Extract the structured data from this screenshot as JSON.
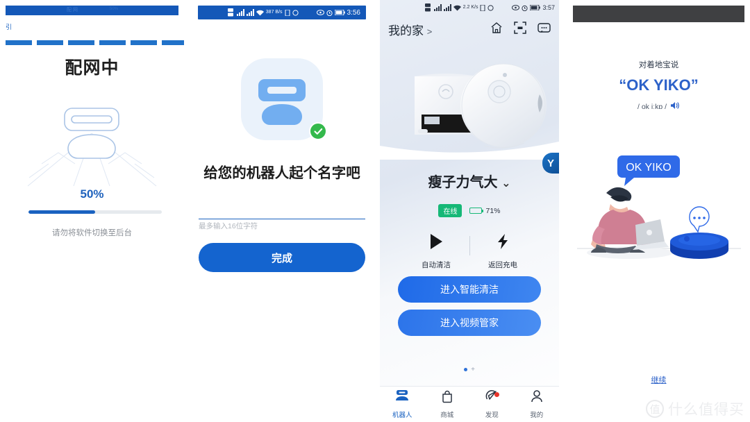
{
  "panel1": {
    "title": "配网中",
    "glitch_text": "配网",
    "glitch_text2": "50%",
    "stray": "引",
    "progress_label": "50%",
    "progress_value": 50,
    "hint": "请勿将软件切换至后台",
    "icons": {
      "illustration": "robot-dock-illustration"
    },
    "colors": {
      "accent": "#1a62c0",
      "track": "#e6eaee"
    }
  },
  "panel2": {
    "statusbar": {
      "network_speed": "387 B/s",
      "time": "3:56",
      "icons": [
        "dual-sim-icon",
        "signal-icon",
        "signal-icon",
        "wifi-icon",
        "speed-icon",
        "vibrate-icon",
        "sync-icon",
        "eye-icon",
        "alarm-icon",
        "battery-icon"
      ]
    },
    "title": "给您的机器人起个名字吧",
    "input_value": "",
    "input_placeholder": "",
    "input_hint": "最多输入16位字符",
    "submit_label": "完成",
    "icons": {
      "avatar": "robot-avatar-icon",
      "status": "success-check-icon"
    },
    "colors": {
      "accent": "#1464cf",
      "success": "#34b94c",
      "avatar_bg": "#eaf2fb"
    }
  },
  "panel3": {
    "statusbar": {
      "network_speed": "2.2 K/s",
      "time": "3:57",
      "icons": [
        "dual-sim-icon",
        "signal-icon",
        "signal-icon",
        "wifi-icon",
        "speed-icon",
        "vibrate-icon",
        "sync-icon",
        "eye-icon",
        "alarm-icon",
        "battery-icon"
      ]
    },
    "header": {
      "home_label": "我的家",
      "chevron": ">",
      "icons": [
        "home-icon",
        "scan-icon",
        "message-icon"
      ]
    },
    "device": {
      "name": "瘦子力气大",
      "chevron": "⌄",
      "status_badge": "在线",
      "battery_text": "71%",
      "battery_percent": 71,
      "brand_badge": "Y",
      "photo_alt": "robot-vacuum-with-dock-photo"
    },
    "actions": [
      {
        "label": "自动清洁",
        "icon": "play-icon"
      },
      {
        "label": "返回充电",
        "icon": "lightning-icon"
      }
    ],
    "buttons": [
      {
        "label": "进入智能清洁"
      },
      {
        "label": "进入视频管家"
      }
    ],
    "pager": {
      "plus": "+"
    },
    "tabs": [
      {
        "label": "机器人",
        "icon": "robot-icon",
        "active": true,
        "badge": false
      },
      {
        "label": "商城",
        "icon": "bag-icon",
        "active": false,
        "badge": false
      },
      {
        "label": "发现",
        "icon": "compass-icon",
        "active": false,
        "badge": true
      },
      {
        "label": "我的",
        "icon": "person-icon",
        "active": false,
        "badge": false
      }
    ],
    "colors": {
      "accent": "#1a62c0",
      "online": "#16b877",
      "badge": "#e8342a"
    }
  },
  "panel4": {
    "say_label": "对着地宝说",
    "wake_word": "“OK YIKO”",
    "phonetic": "/ ok iːkɒ /",
    "speech_bubble": "OK YIKO",
    "continue_label": "继续",
    "icons": {
      "speaker": "speaker-icon",
      "thinking": "thinking-bubble-icon",
      "illustration": "person-with-laptop-and-robot-illustration"
    },
    "watermark": {
      "mark": "值",
      "text": "什么值得买"
    },
    "colors": {
      "accent": "#2d62c9",
      "statusbar": "#3f4042",
      "robot": "#1b4fd0"
    }
  }
}
